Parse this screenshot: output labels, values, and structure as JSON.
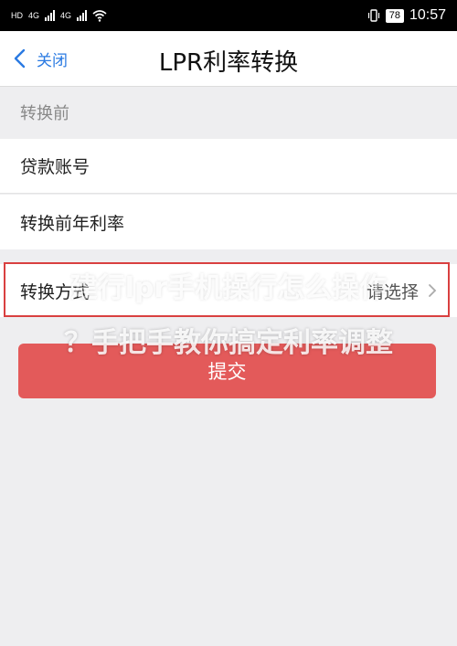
{
  "status_bar": {
    "left_label": "HD",
    "net1": "4G",
    "net2": "4G",
    "battery": "78",
    "time": "10:57"
  },
  "nav": {
    "back_label": "关闭",
    "title": "LPR利率转换"
  },
  "form": {
    "section_header": "转换前",
    "loan_account_label": "贷款账号",
    "pre_rate_label": "转换前年利率",
    "method_label": "转换方式",
    "method_value": "请选择",
    "submit_label": "提交"
  },
  "watermark": {
    "line1": "建行lpr手机操行怎么操作",
    "line2": "？手把手教你搞定利率调整"
  },
  "colors": {
    "accent_blue": "#2a7ae2",
    "submit_red": "#e35a5a",
    "highlight_red": "#d94040"
  }
}
